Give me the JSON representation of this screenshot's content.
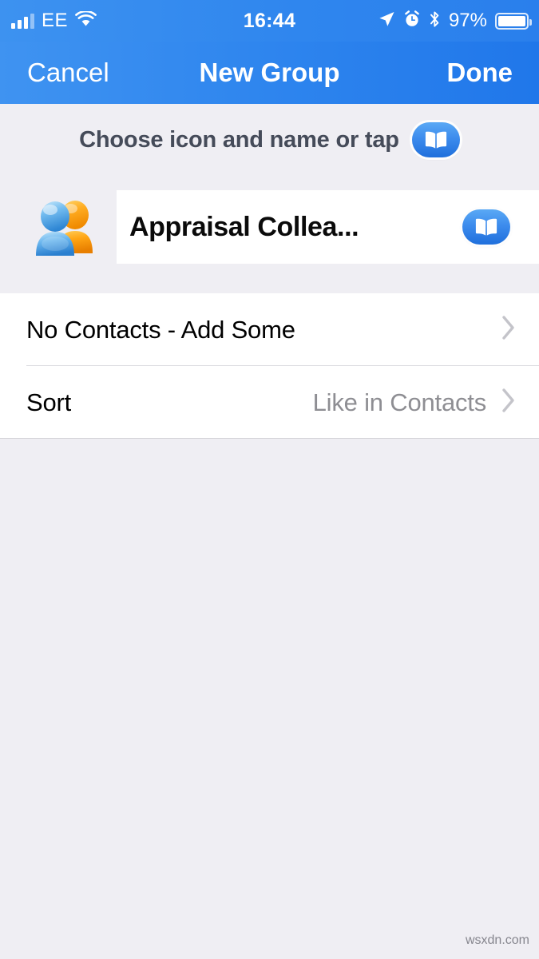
{
  "status_bar": {
    "carrier": "EE",
    "time": "16:44",
    "battery_percent": "97%",
    "icons": [
      "signal-bars-icon",
      "wifi-icon",
      "location-arrow-icon",
      "alarm-clock-icon",
      "bluetooth-icon",
      "battery-icon"
    ]
  },
  "nav_bar": {
    "cancel_label": "Cancel",
    "title": "New Group",
    "done_label": "Done"
  },
  "header": {
    "prompt": "Choose icon and name or tap",
    "book_icon": "book-icon"
  },
  "name_row": {
    "avatar_icon": "two-people-avatar-icon",
    "group_name": "Appraisal Collea...",
    "book_icon": "book-icon"
  },
  "list": {
    "rows": [
      {
        "title": "No Contacts - Add Some",
        "value": "",
        "chevron": "chevron-right-icon"
      },
      {
        "title": "Sort",
        "value": "Like in Contacts",
        "chevron": "chevron-right-icon"
      }
    ]
  },
  "watermark": "wsxdn.com",
  "colors": {
    "nav_blue_left": "#3f93f1",
    "nav_blue_right": "#2077ea",
    "background_gray": "#efeef3",
    "row_white": "#ffffff",
    "secondary_gray": "#8e8e93",
    "prompt_slate": "#454b59",
    "book_blue": "#3d8ced"
  }
}
